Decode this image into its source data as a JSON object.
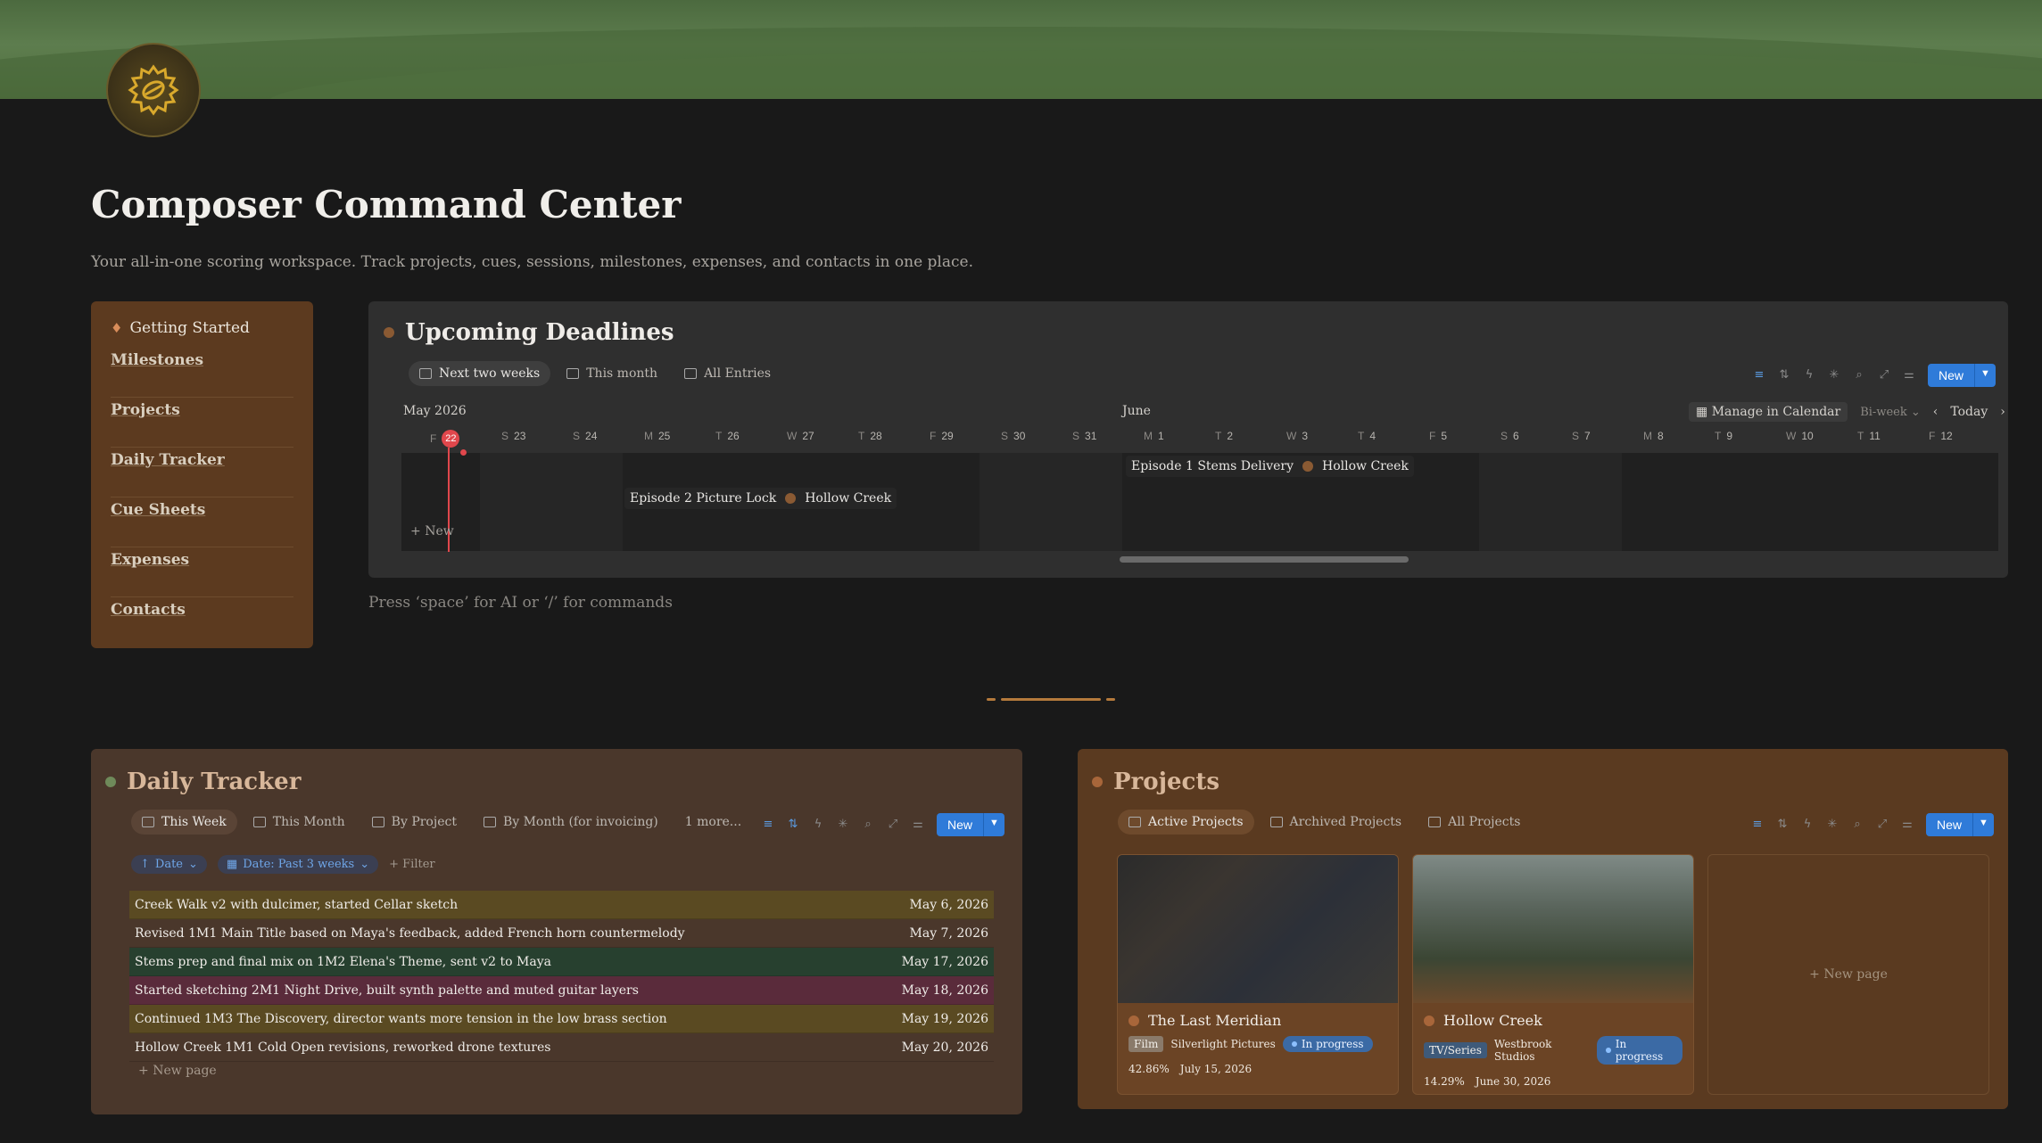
{
  "page": {
    "title": "Composer Command Center",
    "subtitle": "Your all-in-one scoring workspace. Track projects, cues, sessions, milestones, expenses, and contacts in one place.",
    "hint": "Press ‘space’ for AI or ‘/’ for commands"
  },
  "sidebar": {
    "getting_started": "Getting Started",
    "items": [
      {
        "label": "Milestones"
      },
      {
        "label": "Projects"
      },
      {
        "label": "Daily Tracker"
      },
      {
        "label": "Cue Sheets"
      },
      {
        "label": "Expenses"
      },
      {
        "label": "Contacts"
      }
    ]
  },
  "deadlines": {
    "title": "Upcoming Deadlines",
    "tabs": [
      "Next two weeks",
      "This month",
      "All Entries"
    ],
    "new_label": "New",
    "month_may": "May 2026",
    "month_june": "June",
    "manage_label": "Manage in Calendar",
    "biweek_label": "Bi-week",
    "today_label": "Today",
    "cal_new": "New",
    "days": [
      {
        "dow": "F",
        "num": "22"
      },
      {
        "dow": "S",
        "num": "23"
      },
      {
        "dow": "S",
        "num": "24"
      },
      {
        "dow": "M",
        "num": "25"
      },
      {
        "dow": "T",
        "num": "26"
      },
      {
        "dow": "W",
        "num": "27"
      },
      {
        "dow": "T",
        "num": "28"
      },
      {
        "dow": "F",
        "num": "29"
      },
      {
        "dow": "S",
        "num": "30"
      },
      {
        "dow": "S",
        "num": "31"
      },
      {
        "dow": "M",
        "num": "1"
      },
      {
        "dow": "T",
        "num": "2"
      },
      {
        "dow": "W",
        "num": "3"
      },
      {
        "dow": "T",
        "num": "4"
      },
      {
        "dow": "F",
        "num": "5"
      },
      {
        "dow": "S",
        "num": "6"
      },
      {
        "dow": "S",
        "num": "7"
      },
      {
        "dow": "M",
        "num": "8"
      },
      {
        "dow": "T",
        "num": "9"
      },
      {
        "dow": "W",
        "num": "10"
      },
      {
        "dow": "T",
        "num": "11"
      },
      {
        "dow": "F",
        "num": "12"
      }
    ],
    "events": [
      {
        "title": "Episode 2 Picture Lock",
        "project": "Hollow Creek"
      },
      {
        "title": "Episode 1 Stems Delivery",
        "project": "Hollow Creek"
      }
    ]
  },
  "tracker": {
    "title": "Daily Tracker",
    "tabs": [
      "This Week",
      "This Month",
      "By Project",
      "By Month (for invoicing)",
      "1 more..."
    ],
    "new_label": "New",
    "sort_chip": "Date",
    "filter_chip": "Date: Past 3 weeks",
    "add_filter": "Filter",
    "rows": [
      {
        "text": "Creek Walk v2 with dulcimer, started Cellar sketch",
        "date": "May 6, 2026",
        "color": "#5a4a22"
      },
      {
        "text": "Revised 1M1 Main Title based on Maya's feedback, added French horn countermelody",
        "date": "May 7, 2026",
        "color": "#4a372b"
      },
      {
        "text": "Stems prep and final mix on 1M2 Elena's Theme, sent v2 to Maya",
        "date": "May 17, 2026",
        "color": "#27402f"
      },
      {
        "text": "Started sketching 2M1 Night Drive, built synth palette and muted guitar layers",
        "date": "May 18, 2026",
        "color": "#5a2b3b"
      },
      {
        "text": "Continued 1M3 The Discovery, director wants more tension in the low brass section",
        "date": "May 19, 2026",
        "color": "#5a4a22"
      },
      {
        "text": "Hollow Creek 1M1 Cold Open revisions, reworked drone textures",
        "date": "May 20, 2026",
        "color": "#4a372b"
      }
    ],
    "new_page": "New page"
  },
  "projects": {
    "title": "Projects",
    "tabs": [
      "Active Projects",
      "Archived Projects",
      "All Projects"
    ],
    "new_label": "New",
    "cards": [
      {
        "title": "The Last Meridian",
        "type": "Film",
        "studio": "Silverlight Pictures",
        "status": "In progress",
        "progress": "42.86%",
        "date": "July 15, 2026"
      },
      {
        "title": "Hollow Creek",
        "type": "TV/Series",
        "studio": "Westbrook Studios",
        "status": "In progress",
        "progress": "14.29%",
        "date": "June 30, 2026"
      }
    ],
    "new_page": "New page"
  },
  "colors": {
    "accent_blue": "#2f7bd9",
    "today_red": "#e0474c",
    "sidebar_bg": "#5c3a1f",
    "tracker_bg": "#4a372b",
    "projects_bg": "#5a3a20"
  }
}
